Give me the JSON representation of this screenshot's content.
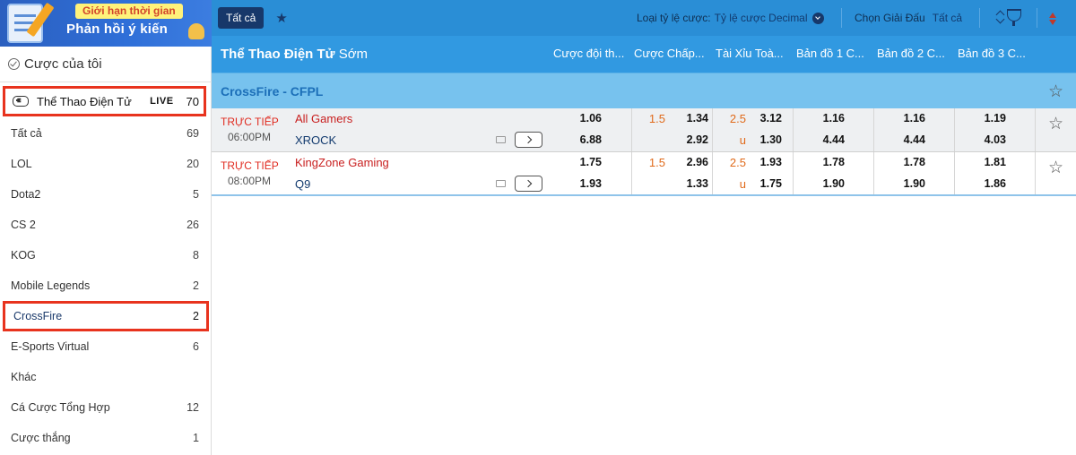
{
  "banner": {
    "tag": "Giới hạn thời gian",
    "title": "Phản hồi ý kiến"
  },
  "sidebar": {
    "my_bets": "Cược của tôi",
    "sport": {
      "label": "Thể Thao Điện Tử",
      "live": "LIVE",
      "count": "70"
    },
    "items": [
      {
        "label": "Tất cả",
        "count": "69"
      },
      {
        "label": "LOL",
        "count": "20"
      },
      {
        "label": "Dota2",
        "count": "5"
      },
      {
        "label": "CS 2",
        "count": "26"
      },
      {
        "label": "KOG",
        "count": "8"
      },
      {
        "label": "Mobile Legends",
        "count": "2"
      },
      {
        "label": "CrossFire",
        "count": "2"
      },
      {
        "label": "E-Sports Virtual",
        "count": "6"
      },
      {
        "label": "Khác",
        "count": ""
      },
      {
        "label": "Cá Cược Tổng Hợp",
        "count": "12"
      },
      {
        "label": "Cược thắng",
        "count": "1"
      }
    ]
  },
  "topbar": {
    "tab_all": "Tất cả",
    "odds_type_label": "Loại tỷ lệ cược:",
    "odds_type_value": "Tỷ lệ cược Decimal",
    "league_label": "Chọn Giải Đấu",
    "league_value": "Tất cả"
  },
  "header": {
    "title_bold": "Thể Thao Điện Tử",
    "title_rest": " Sớm",
    "columns": [
      "Cược đội th...",
      "Cược Chấp...",
      "Tài Xỉu Toà...",
      "Bản đồ 1 C...",
      "Bản đồ 2 C...",
      "Bản đồ 3 C..."
    ]
  },
  "league": {
    "name": "CrossFire - CFPL"
  },
  "matches": [
    {
      "status": "TRỰC TIẾP",
      "time": "06:00PM",
      "home": "All Gamers",
      "away": "XROCK",
      "ml_home": "1.06",
      "ml_away": "6.88",
      "hcp_line": "1.5",
      "hcp_home": "1.34",
      "hcp_away": "2.92",
      "ou_line": "2.5",
      "ou_under": "u",
      "ou_over": "3.12",
      "ou_u": "1.30",
      "map1_home": "1.16",
      "map1_away": "4.44",
      "map2_home": "1.16",
      "map2_away": "4.44",
      "map3_home": "1.19",
      "map3_away": "4.03"
    },
    {
      "status": "TRỰC TIẾP",
      "time": "08:00PM",
      "home": "KingZone Gaming",
      "away": "Q9",
      "ml_home": "1.75",
      "ml_away": "1.93",
      "hcp_line": "1.5",
      "hcp_home": "2.96",
      "hcp_away": "1.33",
      "ou_line": "2.5",
      "ou_under": "u",
      "ou_over": "1.93",
      "ou_u": "1.75",
      "map1_home": "1.78",
      "map1_away": "1.90",
      "map2_home": "1.78",
      "map2_away": "1.90",
      "map3_home": "1.81",
      "map3_away": "1.86"
    }
  ]
}
